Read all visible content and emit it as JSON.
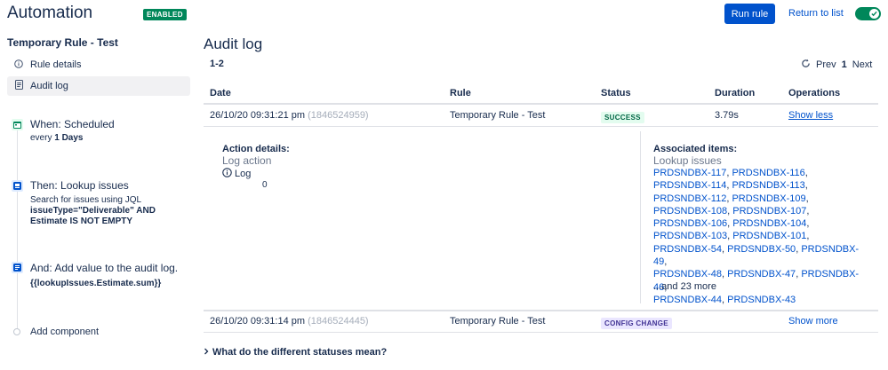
{
  "header": {
    "app_title": "Automation",
    "enabled_badge": "ENABLED",
    "run_rule": "Run rule",
    "return_to_list": "Return to list",
    "rule_enabled": true
  },
  "sidebar": {
    "rule_name": "Temporary Rule - Test",
    "items": [
      {
        "label": "Rule details",
        "icon": "info-icon",
        "active": false
      },
      {
        "label": "Audit log",
        "icon": "document-icon",
        "active": true
      }
    ],
    "steps": [
      {
        "title": "When: Scheduled",
        "icon": "calendar-icon",
        "desc_prefix": "every ",
        "desc_bold": "1 Days"
      },
      {
        "title": "Then: Lookup issues",
        "icon": "search-issues-icon",
        "desc_line1": "Search for issues using JQL",
        "desc_bold": "issueType=\"Deliverable\" AND Estimate IS NOT EMPTY"
      },
      {
        "title": "And: Add value to the audit log.",
        "icon": "audit-log-icon",
        "desc_bold": "{{lookupIssues.Estimate.sum}}"
      }
    ],
    "add_component": "Add component"
  },
  "main": {
    "title": "Audit log",
    "range": "1-2",
    "pager": {
      "prev": "Prev",
      "current": "1",
      "next": "Next"
    },
    "columns": [
      "Date",
      "Rule",
      "Status",
      "Duration",
      "Operations"
    ],
    "rows": [
      {
        "date": "26/10/20 09:31:21 pm",
        "id": "(1846524959)",
        "rule": "Temporary Rule - Test",
        "status": "SUCCESS",
        "duration": "3.79s",
        "operation": "Show less",
        "details": {
          "action_heading": "Action details:",
          "action_name": "Log action",
          "log_label": "Log",
          "log_value": "0",
          "assoc_heading": "Associated items:",
          "assoc_name": "Lookup issues",
          "issue_lines": [
            [
              "PRDSNDBX-117",
              "PRDSNDBX-116"
            ],
            [
              "PRDSNDBX-114",
              "PRDSNDBX-113"
            ],
            [
              "PRDSNDBX-112",
              "PRDSNDBX-109"
            ],
            [
              "PRDSNDBX-108",
              "PRDSNDBX-107"
            ],
            [
              "PRDSNDBX-106",
              "PRDSNDBX-104"
            ],
            [
              "PRDSNDBX-103",
              "PRDSNDBX-101"
            ],
            [
              "PRDSNDBX-54",
              "PRDSNDBX-50",
              "PRDSNDBX-49"
            ],
            [
              "PRDSNDBX-48",
              "PRDSNDBX-47",
              "PRDSNDBX-46"
            ],
            [
              "PRDSNDBX-44",
              "PRDSNDBX-43"
            ]
          ],
          "more": "...and 23 more"
        }
      },
      {
        "date": "26/10/20 09:31:14 pm",
        "id": "(1846524445)",
        "rule": "Temporary Rule - Test",
        "status": "CONFIG CHANGE",
        "duration": "",
        "operation": "Show more"
      }
    ],
    "status_help": "What do the different statuses mean?"
  },
  "colors": {
    "accent": "#0052cc",
    "success": "#00875a",
    "config": "#403294"
  }
}
